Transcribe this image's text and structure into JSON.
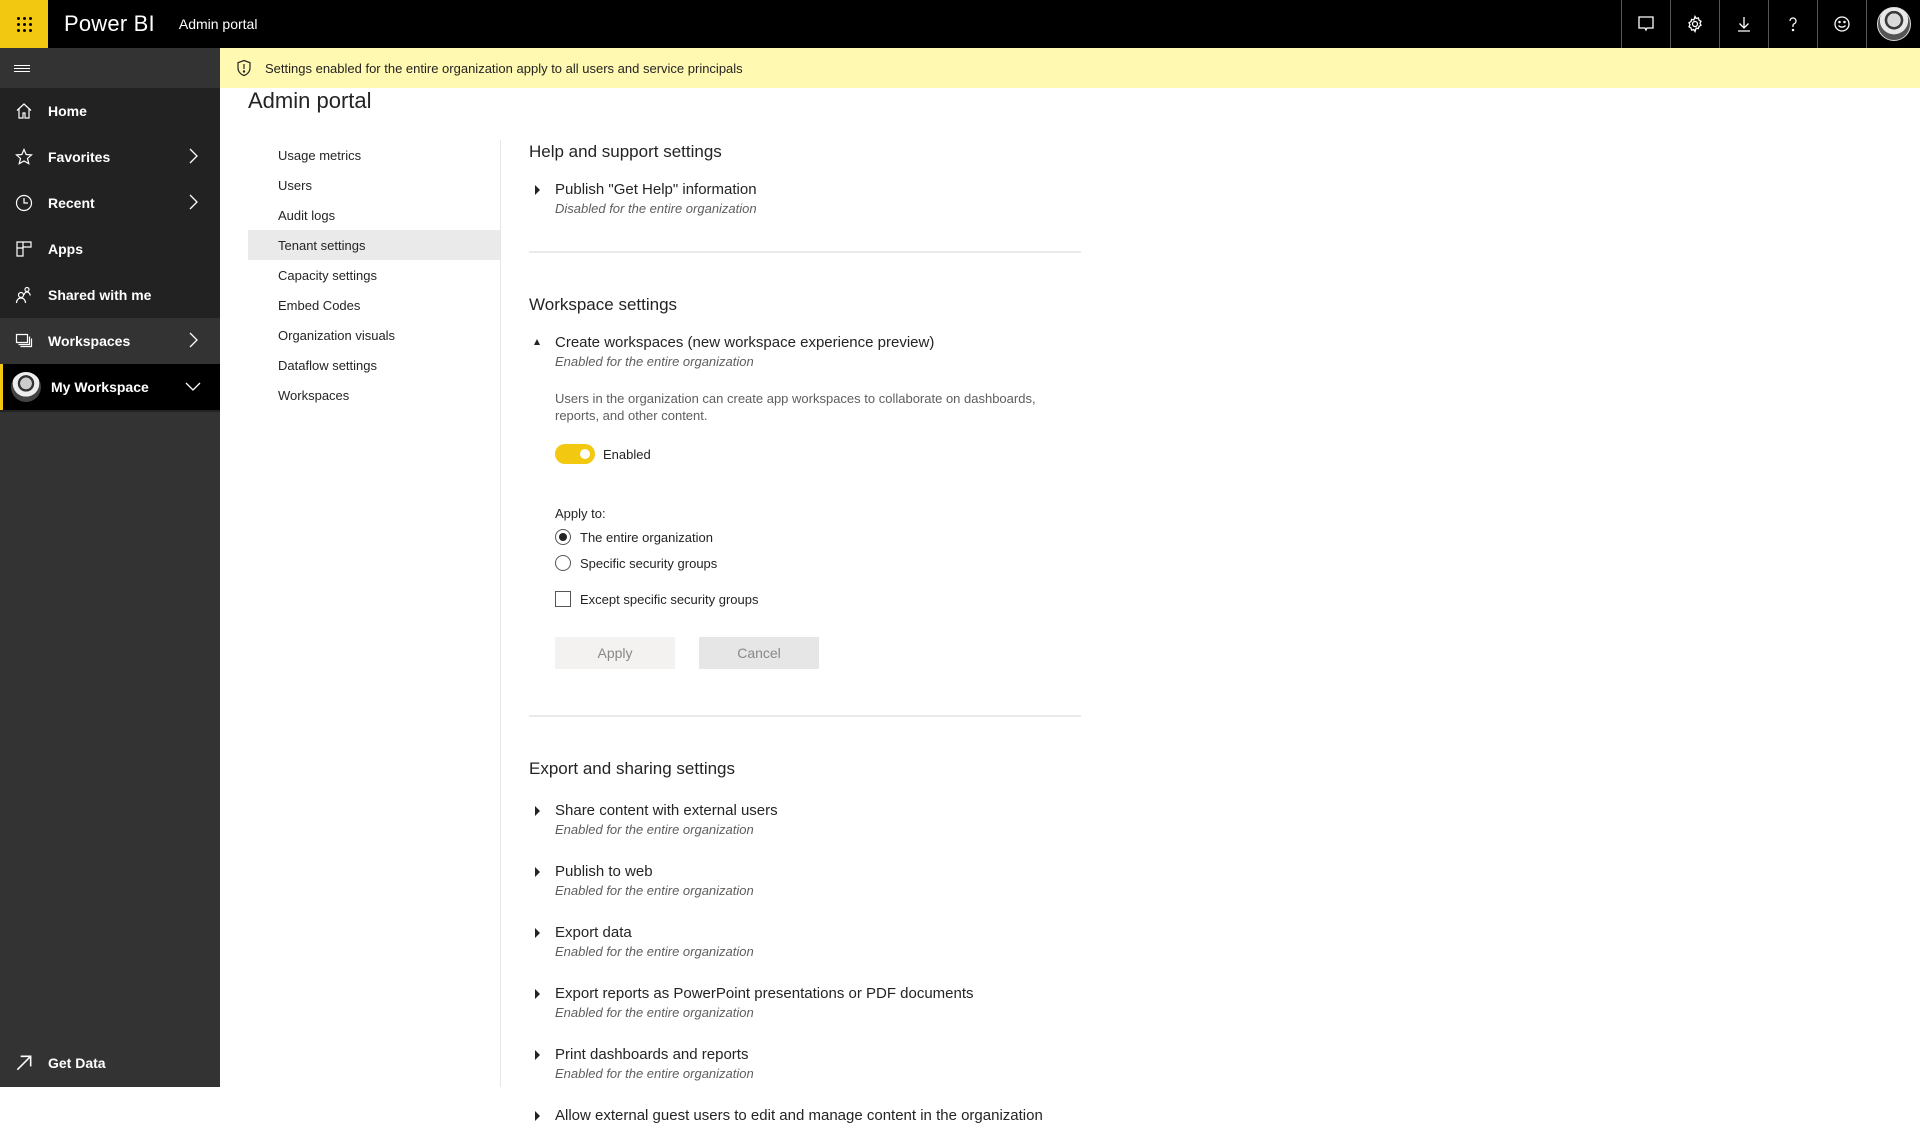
{
  "topbar": {
    "brand": "Power BI",
    "app_title": "Admin portal",
    "actions": [
      "notifications-icon",
      "settings-icon",
      "download-icon",
      "help-icon",
      "feedback-icon",
      "account-avatar"
    ]
  },
  "sidebar": {
    "items": [
      {
        "label": "Home",
        "icon": "home-icon",
        "has_chevron": false
      },
      {
        "label": "Favorites",
        "icon": "star-icon",
        "has_chevron": true
      },
      {
        "label": "Recent",
        "icon": "clock-icon",
        "has_chevron": true
      },
      {
        "label": "Apps",
        "icon": "apps-icon",
        "has_chevron": false
      },
      {
        "label": "Shared with me",
        "icon": "shared-icon",
        "has_chevron": false
      },
      {
        "label": "Workspaces",
        "icon": "workspaces-icon",
        "has_chevron": true
      },
      {
        "label": "My Workspace",
        "icon": "avatar",
        "has_chevron": true
      }
    ],
    "get_data": "Get Data"
  },
  "banner": {
    "text": "Settings enabled for the entire organization apply to all users and service principals"
  },
  "page": {
    "title": "Admin portal"
  },
  "subnav": {
    "items": [
      "Usage metrics",
      "Users",
      "Audit logs",
      "Tenant settings",
      "Capacity settings",
      "Embed Codes",
      "Organization visuals",
      "Dataflow settings",
      "Workspaces"
    ],
    "active": "Tenant settings"
  },
  "sections": {
    "help": {
      "title": "Help and support settings",
      "settings": [
        {
          "name": "Publish \"Get Help\" information",
          "status": "Disabled for the entire organization"
        }
      ]
    },
    "workspace": {
      "title": "Workspace settings",
      "setting": {
        "name": "Create workspaces (new workspace experience preview)",
        "status": "Enabled for the entire organization",
        "description": "Users in the organization can create app workspaces to collaborate on dashboards, reports, and other content.",
        "toggle_label": "Enabled",
        "toggle_on": true,
        "apply_to_label": "Apply to:",
        "options": [
          "The entire organization",
          "Specific security groups"
        ],
        "selected_option": "The entire organization",
        "except_label": "Except specific security groups",
        "except_checked": false,
        "apply_button": "Apply",
        "cancel_button": "Cancel"
      }
    },
    "export": {
      "title": "Export and sharing settings",
      "settings": [
        {
          "name": "Share content with external users",
          "status": "Enabled for the entire organization"
        },
        {
          "name": "Publish to web",
          "status": "Enabled for the entire organization"
        },
        {
          "name": "Export data",
          "status": "Enabled for the entire organization"
        },
        {
          "name": "Export reports as PowerPoint presentations or PDF documents",
          "status": "Enabled for the entire organization"
        },
        {
          "name": "Print dashboards and reports",
          "status": "Enabled for the entire organization"
        },
        {
          "name": "Allow external guest users to edit and manage content in the organization",
          "status": ""
        }
      ]
    }
  },
  "colors": {
    "accent": "#f2c811",
    "topbar": "#000000",
    "sidebar": "#222222",
    "banner": "#fff9b1"
  }
}
